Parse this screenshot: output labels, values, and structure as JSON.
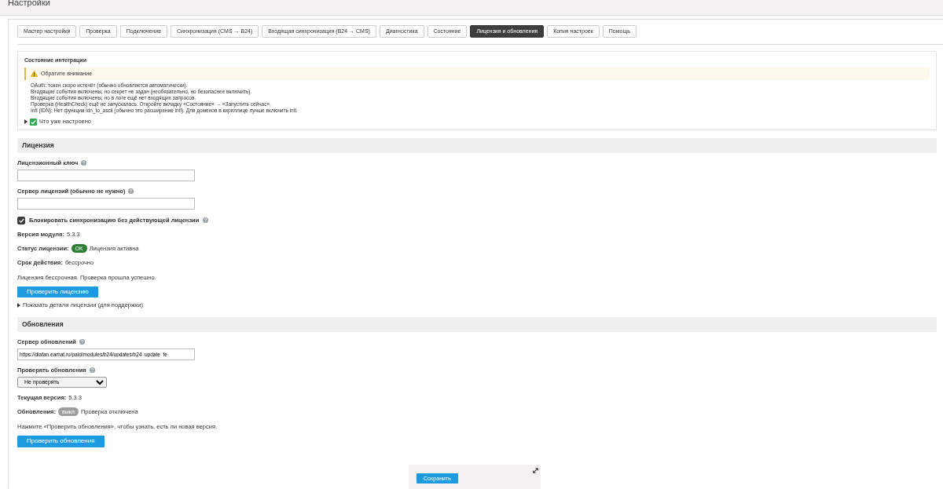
{
  "page_title": "Настройки",
  "tabs": [
    {
      "label": "Мастер настройки",
      "selected": false
    },
    {
      "label": "Проверка",
      "selected": false
    },
    {
      "label": "Подключение",
      "selected": false
    },
    {
      "label": "Синхронизация (CMS → B24)",
      "selected": false
    },
    {
      "label": "Входящая синхронизация (B24 → CMS)",
      "selected": false
    },
    {
      "label": "Диагностика",
      "selected": false
    },
    {
      "label": "Состояние",
      "selected": false
    },
    {
      "label": "Лицензия и обновления",
      "selected": true
    },
    {
      "label": "Копия настроек",
      "selected": false
    },
    {
      "label": "Помощь",
      "selected": false
    }
  ],
  "integration_status": {
    "title": "Состояние интеграции",
    "alert": "Обратите внимание",
    "messages": [
      "OAuth: токен скоро истечёт (обычно обновляется автоматически).",
      "Входящие события включены, но секрет не задан (необязательно, но безопаснее включить).",
      "Входящие события включены, но в логе ещё нет входящих запросов.",
      "Проверка (HealthCheck) ещё не запускалась. Откройте вкладку «Состояние» → «Запустить сейчас».",
      "Intl (IDN): Нет функции idn_to_ascii (обычно это расширение intl). Для доменов в кириллице лучше включить intl."
    ],
    "configured": {
      "label": "Что уже настроено",
      "expanded": false
    }
  },
  "license": {
    "title": "Лицензия",
    "fields": [
      {
        "label": "Лицензионный ключ"
      },
      {
        "label": "Сервер лицензий (обычно не нужно)"
      }
    ],
    "block_sync": {
      "label": "Блокировать синхронизацию без действующей лицензии",
      "checked": true
    },
    "rows": [
      {
        "label": "Версия модуля:",
        "value": "5.3.3"
      },
      {
        "label": "Статус лицензии:",
        "badge": "OK",
        "color": "#2e7d32",
        "value": "Лицензия активна"
      },
      {
        "label": "Срок действия:",
        "value": "бессрочно"
      }
    ],
    "note": "Лицензия бессрочная. Проверка прошла успешно.",
    "button": "Проверить лицензию",
    "details": {
      "label": "Показать детали лицензии (для поддержки)",
      "expanded": false
    }
  },
  "updates": {
    "title": "Обновления",
    "server_field": {
      "label": "Сервер обновлений",
      "value": "https://diafan.eamat.ru/paid/modules/b24/updates/b24_update_fe"
    },
    "check_select": {
      "label": "Проверять обновления",
      "value": "Не проверять"
    },
    "rows": [
      {
        "label": "Текущая версия:",
        "value": "5.3.3"
      },
      {
        "label": "Обновления:",
        "badge": "выкл",
        "color": "#9e9e9e",
        "value": "Проверка отключена"
      }
    ],
    "note": "Нажмите «Проверить обновления», чтобы узнать, есть ли новая версия.",
    "button": "Проверить обновления"
  },
  "save_button": "Сохранить"
}
